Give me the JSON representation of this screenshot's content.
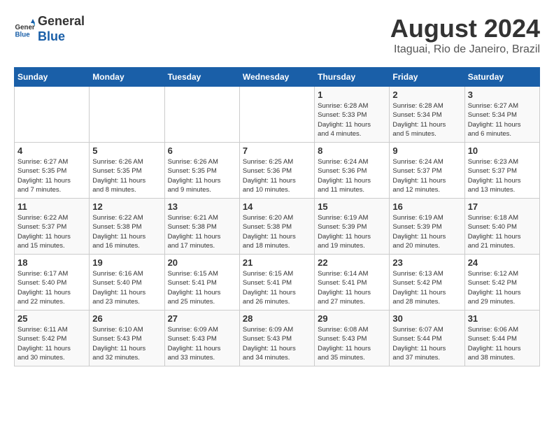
{
  "header": {
    "logo_general": "General",
    "logo_blue": "Blue",
    "month_year": "August 2024",
    "location": "Itaguai, Rio de Janeiro, Brazil"
  },
  "weekdays": [
    "Sunday",
    "Monday",
    "Tuesday",
    "Wednesday",
    "Thursday",
    "Friday",
    "Saturday"
  ],
  "weeks": [
    [
      {
        "day": "",
        "info": ""
      },
      {
        "day": "",
        "info": ""
      },
      {
        "day": "",
        "info": ""
      },
      {
        "day": "",
        "info": ""
      },
      {
        "day": "1",
        "info": "Sunrise: 6:28 AM\nSunset: 5:33 PM\nDaylight: 11 hours\nand 4 minutes."
      },
      {
        "day": "2",
        "info": "Sunrise: 6:28 AM\nSunset: 5:34 PM\nDaylight: 11 hours\nand 5 minutes."
      },
      {
        "day": "3",
        "info": "Sunrise: 6:27 AM\nSunset: 5:34 PM\nDaylight: 11 hours\nand 6 minutes."
      }
    ],
    [
      {
        "day": "4",
        "info": "Sunrise: 6:27 AM\nSunset: 5:35 PM\nDaylight: 11 hours\nand 7 minutes."
      },
      {
        "day": "5",
        "info": "Sunrise: 6:26 AM\nSunset: 5:35 PM\nDaylight: 11 hours\nand 8 minutes."
      },
      {
        "day": "6",
        "info": "Sunrise: 6:26 AM\nSunset: 5:35 PM\nDaylight: 11 hours\nand 9 minutes."
      },
      {
        "day": "7",
        "info": "Sunrise: 6:25 AM\nSunset: 5:36 PM\nDaylight: 11 hours\nand 10 minutes."
      },
      {
        "day": "8",
        "info": "Sunrise: 6:24 AM\nSunset: 5:36 PM\nDaylight: 11 hours\nand 11 minutes."
      },
      {
        "day": "9",
        "info": "Sunrise: 6:24 AM\nSunset: 5:37 PM\nDaylight: 11 hours\nand 12 minutes."
      },
      {
        "day": "10",
        "info": "Sunrise: 6:23 AM\nSunset: 5:37 PM\nDaylight: 11 hours\nand 13 minutes."
      }
    ],
    [
      {
        "day": "11",
        "info": "Sunrise: 6:22 AM\nSunset: 5:37 PM\nDaylight: 11 hours\nand 15 minutes."
      },
      {
        "day": "12",
        "info": "Sunrise: 6:22 AM\nSunset: 5:38 PM\nDaylight: 11 hours\nand 16 minutes."
      },
      {
        "day": "13",
        "info": "Sunrise: 6:21 AM\nSunset: 5:38 PM\nDaylight: 11 hours\nand 17 minutes."
      },
      {
        "day": "14",
        "info": "Sunrise: 6:20 AM\nSunset: 5:38 PM\nDaylight: 11 hours\nand 18 minutes."
      },
      {
        "day": "15",
        "info": "Sunrise: 6:19 AM\nSunset: 5:39 PM\nDaylight: 11 hours\nand 19 minutes."
      },
      {
        "day": "16",
        "info": "Sunrise: 6:19 AM\nSunset: 5:39 PM\nDaylight: 11 hours\nand 20 minutes."
      },
      {
        "day": "17",
        "info": "Sunrise: 6:18 AM\nSunset: 5:40 PM\nDaylight: 11 hours\nand 21 minutes."
      }
    ],
    [
      {
        "day": "18",
        "info": "Sunrise: 6:17 AM\nSunset: 5:40 PM\nDaylight: 11 hours\nand 22 minutes."
      },
      {
        "day": "19",
        "info": "Sunrise: 6:16 AM\nSunset: 5:40 PM\nDaylight: 11 hours\nand 23 minutes."
      },
      {
        "day": "20",
        "info": "Sunrise: 6:15 AM\nSunset: 5:41 PM\nDaylight: 11 hours\nand 25 minutes."
      },
      {
        "day": "21",
        "info": "Sunrise: 6:15 AM\nSunset: 5:41 PM\nDaylight: 11 hours\nand 26 minutes."
      },
      {
        "day": "22",
        "info": "Sunrise: 6:14 AM\nSunset: 5:41 PM\nDaylight: 11 hours\nand 27 minutes."
      },
      {
        "day": "23",
        "info": "Sunrise: 6:13 AM\nSunset: 5:42 PM\nDaylight: 11 hours\nand 28 minutes."
      },
      {
        "day": "24",
        "info": "Sunrise: 6:12 AM\nSunset: 5:42 PM\nDaylight: 11 hours\nand 29 minutes."
      }
    ],
    [
      {
        "day": "25",
        "info": "Sunrise: 6:11 AM\nSunset: 5:42 PM\nDaylight: 11 hours\nand 30 minutes."
      },
      {
        "day": "26",
        "info": "Sunrise: 6:10 AM\nSunset: 5:43 PM\nDaylight: 11 hours\nand 32 minutes."
      },
      {
        "day": "27",
        "info": "Sunrise: 6:09 AM\nSunset: 5:43 PM\nDaylight: 11 hours\nand 33 minutes."
      },
      {
        "day": "28",
        "info": "Sunrise: 6:09 AM\nSunset: 5:43 PM\nDaylight: 11 hours\nand 34 minutes."
      },
      {
        "day": "29",
        "info": "Sunrise: 6:08 AM\nSunset: 5:43 PM\nDaylight: 11 hours\nand 35 minutes."
      },
      {
        "day": "30",
        "info": "Sunrise: 6:07 AM\nSunset: 5:44 PM\nDaylight: 11 hours\nand 37 minutes."
      },
      {
        "day": "31",
        "info": "Sunrise: 6:06 AM\nSunset: 5:44 PM\nDaylight: 11 hours\nand 38 minutes."
      }
    ]
  ]
}
